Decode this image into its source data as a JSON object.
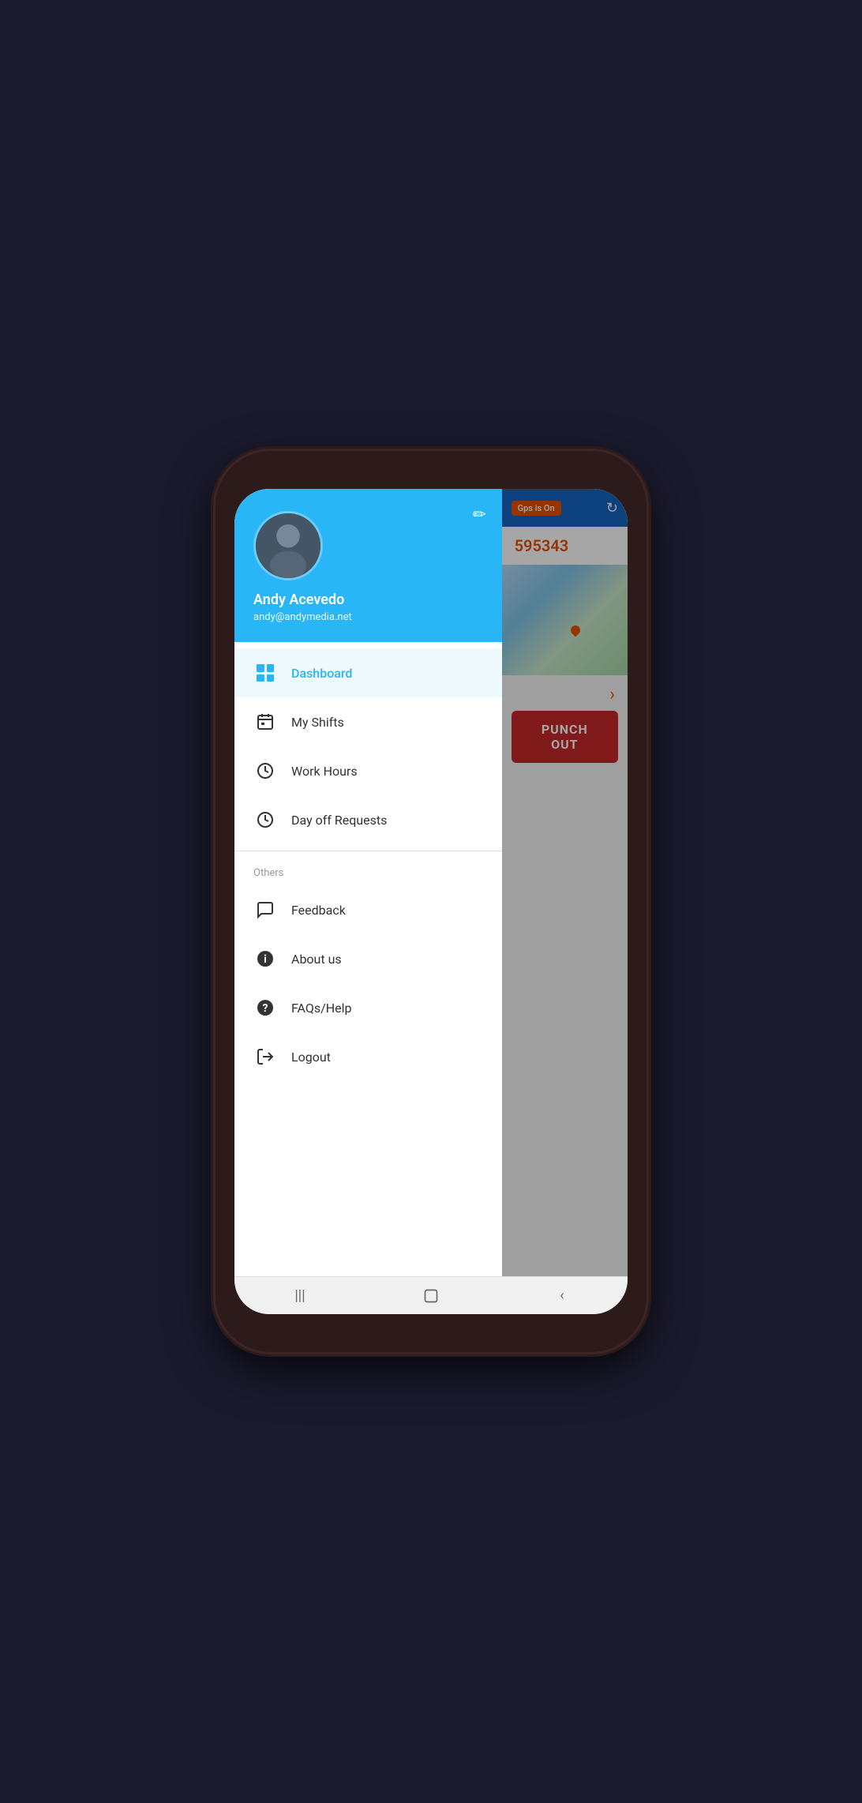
{
  "user": {
    "name": "Andy Acevedo",
    "email": "andy@andymedia.net"
  },
  "menu": {
    "active_item": "dashboard",
    "items": [
      {
        "id": "dashboard",
        "label": "Dashboard",
        "icon": "dashboard-icon",
        "active": true
      },
      {
        "id": "my-shifts",
        "label": "My Shifts",
        "icon": "calendar-icon",
        "active": false
      },
      {
        "id": "work-hours",
        "label": "Work Hours",
        "icon": "clock-icon",
        "active": false
      },
      {
        "id": "day-off-requests",
        "label": "Day off Requests",
        "icon": "clock-icon",
        "active": false
      }
    ],
    "others_label": "Others",
    "others_items": [
      {
        "id": "feedback",
        "label": "Feedback",
        "icon": "chat-icon"
      },
      {
        "id": "about-us",
        "label": "About us",
        "icon": "info-icon"
      },
      {
        "id": "faqs-help",
        "label": "FAQs/Help",
        "icon": "help-icon"
      },
      {
        "id": "logout",
        "label": "Logout",
        "icon": "logout-icon"
      }
    ]
  },
  "background": {
    "gps_label": "Gps is On",
    "id_text": "595343",
    "punch_btn_label": "PUNCH OUT"
  },
  "bottom_nav": {
    "menu_icon": "|||",
    "home_icon": "⬜",
    "back_icon": "<"
  }
}
